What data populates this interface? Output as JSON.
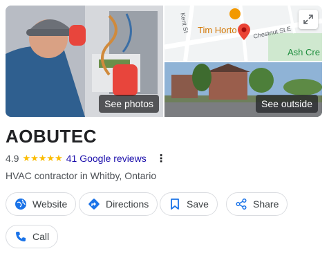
{
  "photos": {
    "see_photos_label": "See photos",
    "see_outside_label": "See outside",
    "map": {
      "poi_label": "Tim Horto",
      "street_kent": "Kent St",
      "street_chestnut": "Chestnut St E",
      "green_label": "Ash Cre"
    }
  },
  "business": {
    "name": "AOBUTEC",
    "rating": "4.9",
    "stars": "★★★★★",
    "reviews_label": "41 Google reviews",
    "more_symbol": "⋮",
    "category": "HVAC contractor in Whitby, Ontario"
  },
  "actions": {
    "website": "Website",
    "directions": "Directions",
    "save": "Save",
    "share": "Share",
    "call": "Call"
  },
  "colors": {
    "accent_blue": "#1a73e8",
    "link_blue": "#1a0dab",
    "star_yellow": "#fbbc04",
    "map_pin_red": "#ea4335"
  },
  "icons": [
    "globe-icon",
    "directions-icon",
    "bookmark-icon",
    "share-icon",
    "phone-icon",
    "expand-icon",
    "map-pin-icon",
    "coffee-cup-icon"
  ]
}
